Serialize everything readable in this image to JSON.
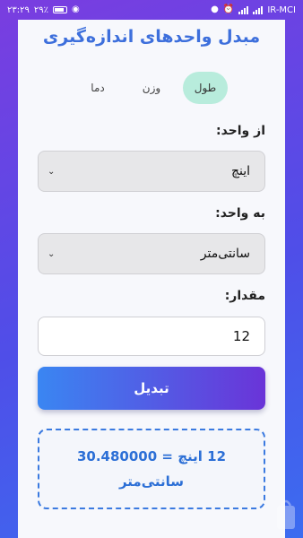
{
  "status_bar": {
    "time": "۲۳:۲۹",
    "battery": "۲۹٪",
    "carrier": "IR-MCI"
  },
  "app": {
    "title": "مبدل واحدهای اندازه‌گیری"
  },
  "tabs": [
    {
      "label": "طول",
      "active": true
    },
    {
      "label": "وزن",
      "active": false
    },
    {
      "label": "دما",
      "active": false
    }
  ],
  "from": {
    "label": "از واحد:",
    "selected": "اینچ"
  },
  "to": {
    "label": "به واحد:",
    "selected": "سانتی‌متر"
  },
  "amount": {
    "label": "مقدار:",
    "value": "12"
  },
  "convert_button": {
    "label": "تبدیل"
  },
  "result": {
    "line1": "12 اینچ = 30.480000",
    "line2": "سانتی‌متر"
  },
  "colors": {
    "accent": "#3d6fdc",
    "active_tab": "#b8ecdc",
    "button_start": "#3a86f2",
    "button_end": "#6a34d8",
    "background_start": "#7a3de0",
    "background_end": "#3b6cf0"
  }
}
